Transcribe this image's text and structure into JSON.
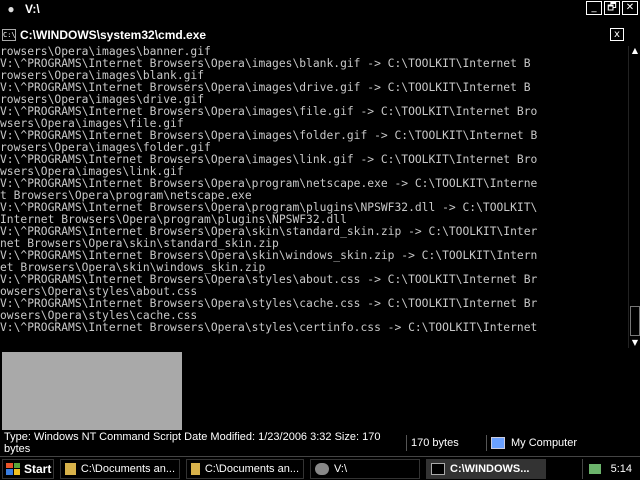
{
  "outer_window": {
    "title": "V:\\",
    "buttons": [
      "_",
      "🗗",
      "✕"
    ]
  },
  "console": {
    "title": "C:\\WINDOWS\\system32\\cmd.exe",
    "close_label": "x",
    "lines": [
      "rowsers\\Opera\\images\\banner.gif",
      "V:\\^PROGRAMS\\Internet Browsers\\Opera\\images\\blank.gif -> C:\\TOOLKIT\\Internet B",
      "rowsers\\Opera\\images\\blank.gif",
      "V:\\^PROGRAMS\\Internet Browsers\\Opera\\images\\drive.gif -> C:\\TOOLKIT\\Internet B",
      "rowsers\\Opera\\images\\drive.gif",
      "V:\\^PROGRAMS\\Internet Browsers\\Opera\\images\\file.gif -> C:\\TOOLKIT\\Internet Bro",
      "wsers\\Opera\\images\\file.gif",
      "V:\\^PROGRAMS\\Internet Browsers\\Opera\\images\\folder.gif -> C:\\TOOLKIT\\Internet B",
      "rowsers\\Opera\\images\\folder.gif",
      "V:\\^PROGRAMS\\Internet Browsers\\Opera\\images\\link.gif -> C:\\TOOLKIT\\Internet Bro",
      "wsers\\Opera\\images\\link.gif",
      "V:\\^PROGRAMS\\Internet Browsers\\Opera\\program\\netscape.exe -> C:\\TOOLKIT\\Interne",
      "t Browsers\\Opera\\program\\netscape.exe",
      "V:\\^PROGRAMS\\Internet Browsers\\Opera\\program\\plugins\\NPSWF32.dll -> C:\\TOOLKIT\\",
      "Internet Browsers\\Opera\\program\\plugins\\NPSWF32.dll",
      "V:\\^PROGRAMS\\Internet Browsers\\Opera\\skin\\standard_skin.zip -> C:\\TOOLKIT\\Inter",
      "net Browsers\\Opera\\skin\\standard_skin.zip",
      "V:\\^PROGRAMS\\Internet Browsers\\Opera\\skin\\windows_skin.zip -> C:\\TOOLKIT\\Intern",
      "et Browsers\\Opera\\skin\\windows_skin.zip",
      "V:\\^PROGRAMS\\Internet Browsers\\Opera\\styles\\about.css -> C:\\TOOLKIT\\Internet Br",
      "owsers\\Opera\\styles\\about.css",
      "V:\\^PROGRAMS\\Internet Browsers\\Opera\\styles\\cache.css -> C:\\TOOLKIT\\Internet Br",
      "owsers\\Opera\\styles\\cache.css",
      "V:\\^PROGRAMS\\Internet Browsers\\Opera\\styles\\certinfo.css -> C:\\TOOLKIT\\Internet"
    ]
  },
  "statusbar": {
    "main": "Type: Windows NT Command Script Date Modified: 1/23/2006 3:32 Size: 170 bytes",
    "size": "170 bytes",
    "zone": "My Computer"
  },
  "taskbar": {
    "start": "Start",
    "items": [
      "C:\\Documents an...",
      "C:\\Documents an...",
      "V:\\",
      "C:\\WINDOWS..."
    ],
    "clock": "5:14"
  },
  "colors": {
    "console_text": "#c8c8c8",
    "preview_panel": "#a9a9a9",
    "active_task": "#333333"
  }
}
